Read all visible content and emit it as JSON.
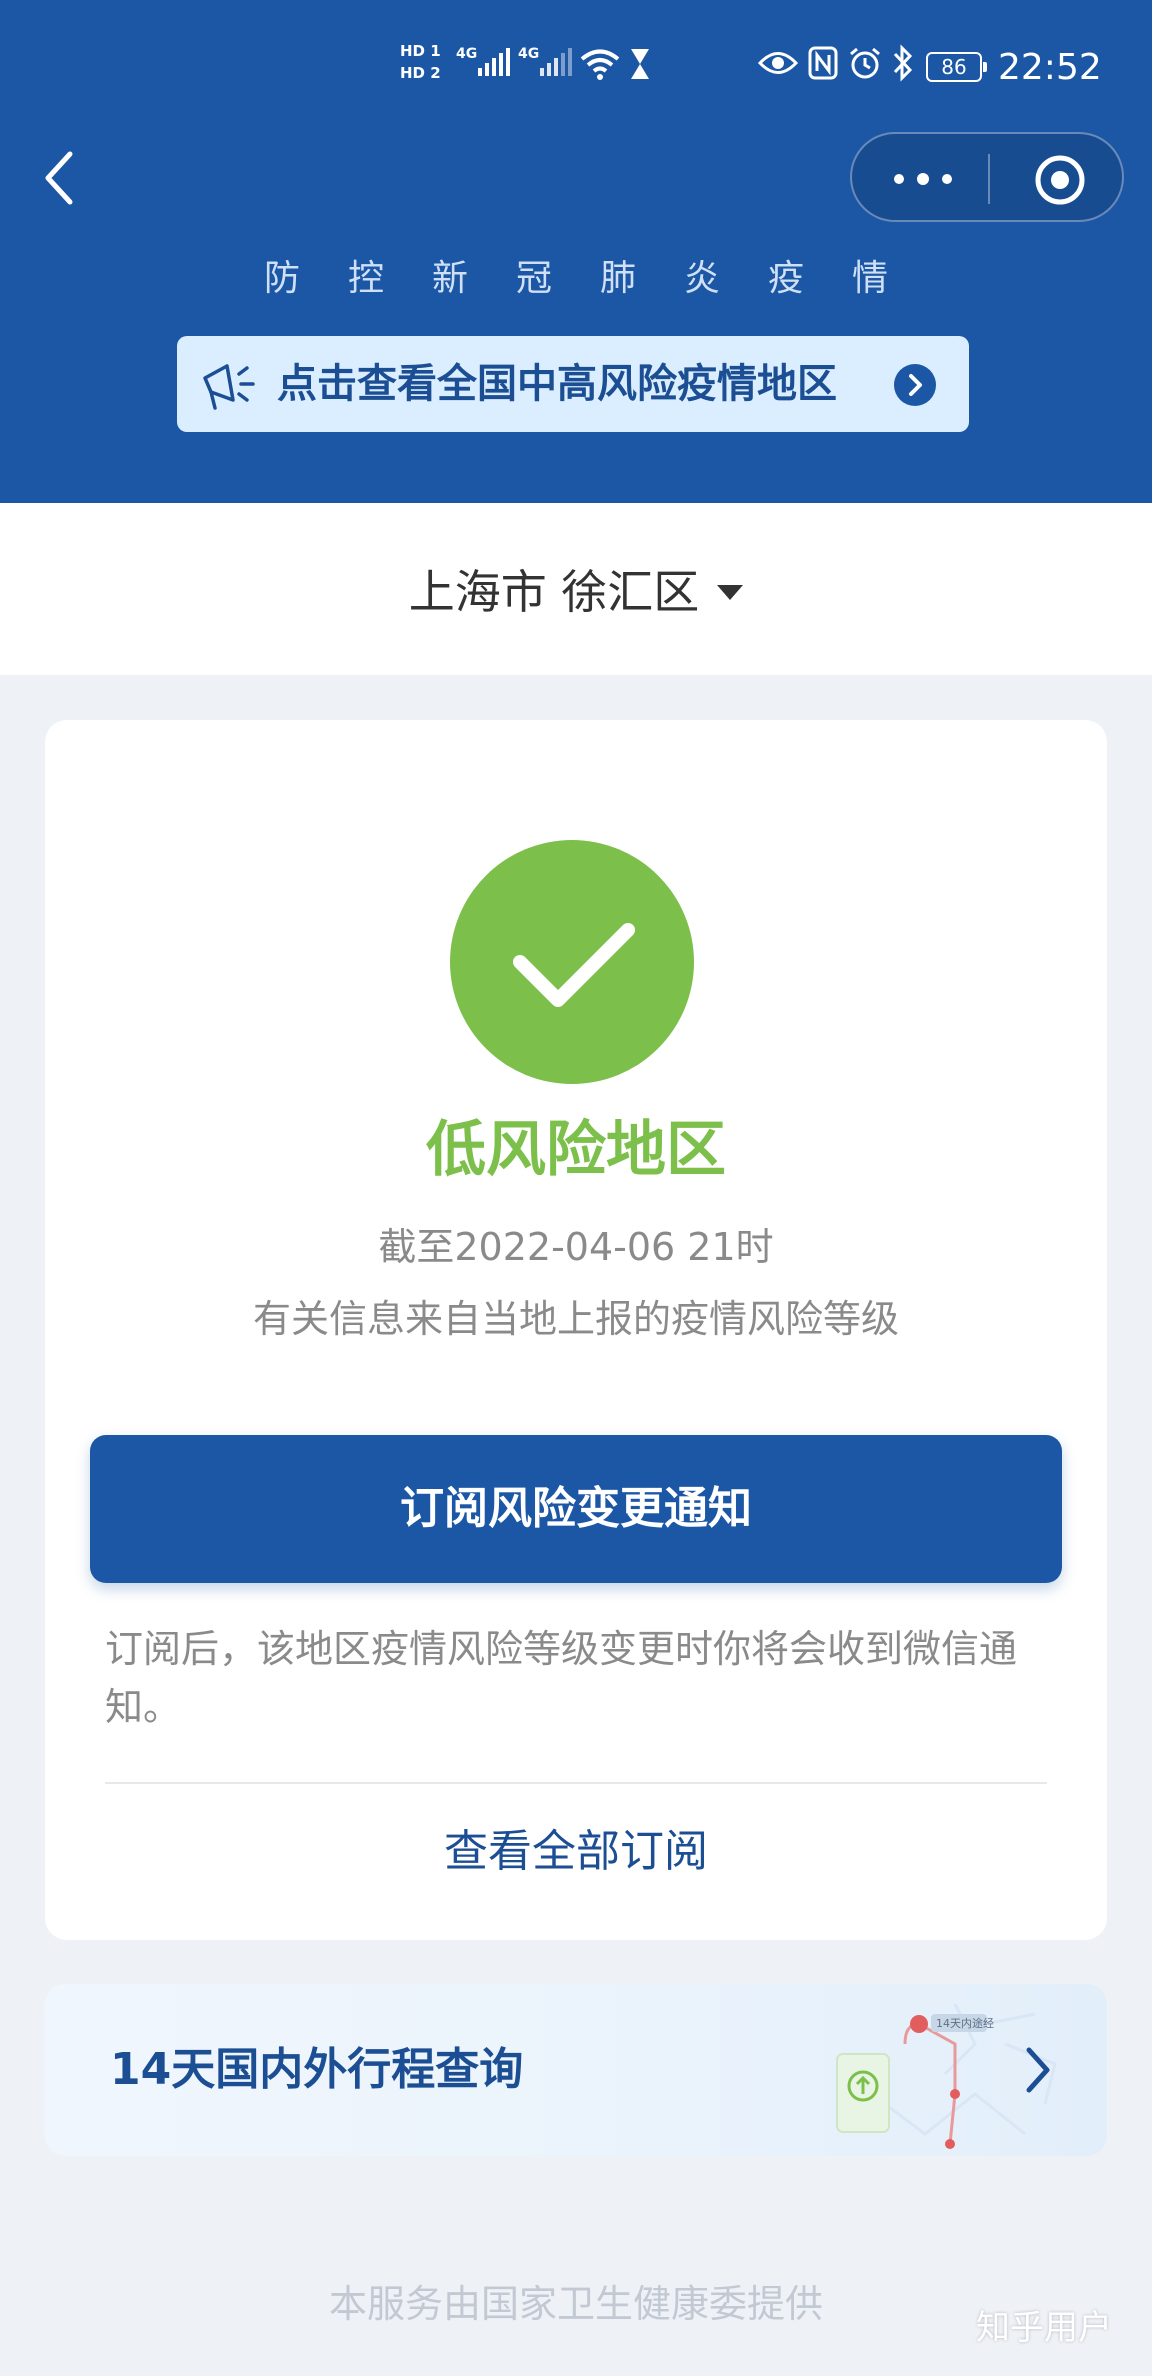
{
  "status_bar": {
    "sim1": "HD 1",
    "sim2": "HD 2",
    "net1": "4G",
    "net2": "4G",
    "battery": "86",
    "time": "22:52"
  },
  "header": {
    "subtitle": "防控新冠肺炎疫情",
    "banner_text": "点击查看全国中高风险疫情地区"
  },
  "region": {
    "label": "上海市 徐汇区"
  },
  "risk_card": {
    "level": "低风险地区",
    "as_of": "截至2022-04-06 21时",
    "source_note": "有关信息来自当地上报的疫情风险等级",
    "subscribe_label": "订阅风险变更通知",
    "subscribe_desc": "订阅后，该地区疫情风险等级变更时你将会收到微信通知。",
    "view_all_label": "查看全部订阅"
  },
  "travel": {
    "title": "14天国内外行程查询",
    "tag": "14天内途经"
  },
  "footer": {
    "provider": "本服务由国家卫生健康委提供"
  },
  "watermark": "知乎用户",
  "colors": {
    "brand_blue": "#1c57a6",
    "low_risk_green": "#7cc04b",
    "banner_bg": "#dbeeff",
    "page_bg": "#eef2f7"
  },
  "icons": {
    "back": "chevron-left-icon",
    "more": "more-dots-icon",
    "close": "target-circle-icon",
    "megaphone": "megaphone-icon",
    "check": "checkmark-icon",
    "caret": "caret-down-icon",
    "arrow": "chevron-right-icon"
  }
}
